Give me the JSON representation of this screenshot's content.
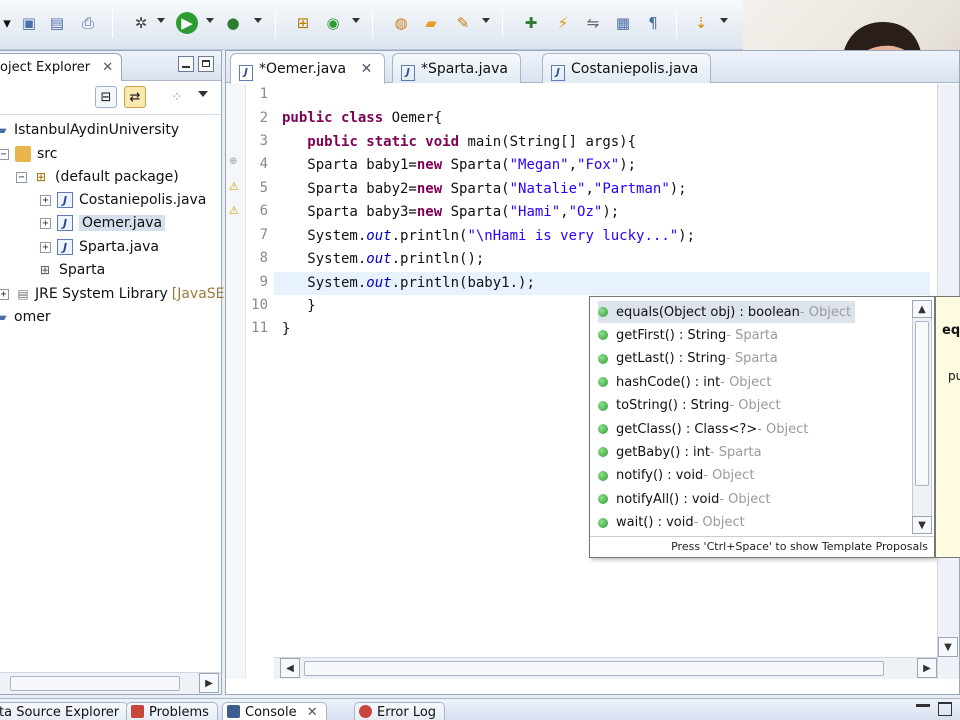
{
  "explorer": {
    "tab_label": "Project Explorer",
    "tab_visible": "oject Explorer",
    "tree": [
      {
        "label": "IstanbulAydinUniversity",
        "type": "project"
      },
      {
        "label": "src",
        "type": "folder"
      },
      {
        "label": "(default package)",
        "type": "package"
      },
      {
        "label": "Costaniepolis.java",
        "type": "java"
      },
      {
        "label": "Oemer.java",
        "type": "java"
      },
      {
        "label": "Sparta.java",
        "type": "java"
      },
      {
        "label": "Sparta",
        "type": "class"
      },
      {
        "label": "JRE System Library",
        "suffix": "[JavaSE-",
        "type": "library"
      },
      {
        "label": "omer",
        "type": "project"
      }
    ]
  },
  "editor": {
    "tabs": [
      {
        "label": "*Oemer.java",
        "active": true
      },
      {
        "label": "*Sparta.java",
        "active": false
      },
      {
        "label": "Costaniepolis.java",
        "active": false
      }
    ],
    "line_numbers": [
      "1",
      "2",
      "3",
      "4",
      "5",
      "6",
      "7",
      "8",
      "9",
      "10",
      "11"
    ]
  },
  "content_assist": {
    "proposals": [
      {
        "sig": "equals(Object obj) : boolean",
        "owner": "Object",
        "selected": true
      },
      {
        "sig": "getFirst() : String",
        "owner": "Sparta"
      },
      {
        "sig": "getLast() : String",
        "owner": "Sparta"
      },
      {
        "sig": "hashCode() : int",
        "owner": "Object"
      },
      {
        "sig": "toString() : String",
        "owner": "Object"
      },
      {
        "sig": "getClass() : Class<?>",
        "owner": "Object"
      },
      {
        "sig": "getBaby() : int",
        "owner": "Sparta"
      },
      {
        "sig": "notify() : void",
        "owner": "Object"
      },
      {
        "sig": "notifyAll() : void",
        "owner": "Object"
      },
      {
        "sig": "wait() : void",
        "owner": "Object"
      }
    ],
    "footer": "Press 'Ctrl+Space' to show Template Proposals",
    "doc_text": "eq",
    "doc_text2": "pu"
  },
  "bottom_tabs": [
    {
      "label": "ta Source Explorer"
    },
    {
      "label": "Problems"
    },
    {
      "label": "Console",
      "active": true
    },
    {
      "label": "Error Log"
    }
  ]
}
